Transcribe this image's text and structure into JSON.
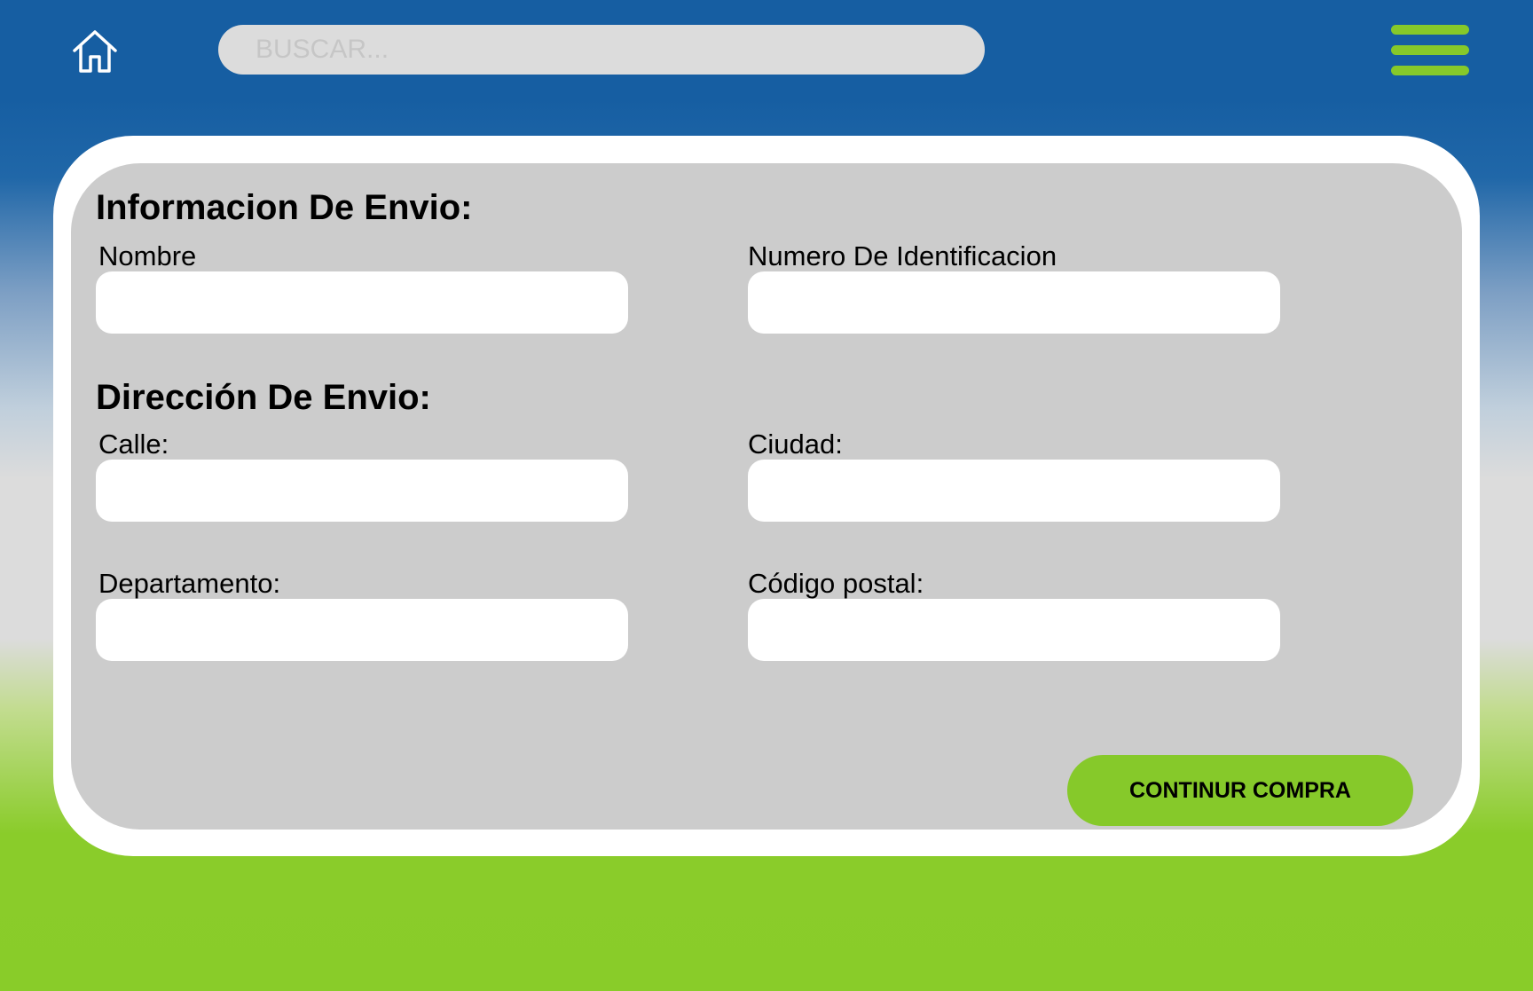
{
  "header": {
    "home_icon": "home-icon",
    "menu_icon": "hamburger-menu-icon",
    "menu_color": "#86c92a",
    "search": {
      "placeholder": "BUSCAR...",
      "value": ""
    }
  },
  "shipping_info": {
    "title": "Informacion De Envio:",
    "fields": [
      {
        "label": "Nombre",
        "value": ""
      },
      {
        "label": "Numero De Identificacion",
        "value": ""
      }
    ]
  },
  "shipping_address": {
    "title": "Dirección De Envio:",
    "fields": [
      {
        "label": "Calle:",
        "value": ""
      },
      {
        "label": "Ciudad:",
        "value": ""
      },
      {
        "label": "Departamento:",
        "value": ""
      },
      {
        "label": "Código postal:",
        "value": ""
      }
    ]
  },
  "actions": {
    "continue_label": "CONTINUR COMPRA"
  },
  "colors": {
    "header_blue": "#165ea2",
    "accent_green": "#86c92a",
    "panel_gray": "#cccccc"
  }
}
